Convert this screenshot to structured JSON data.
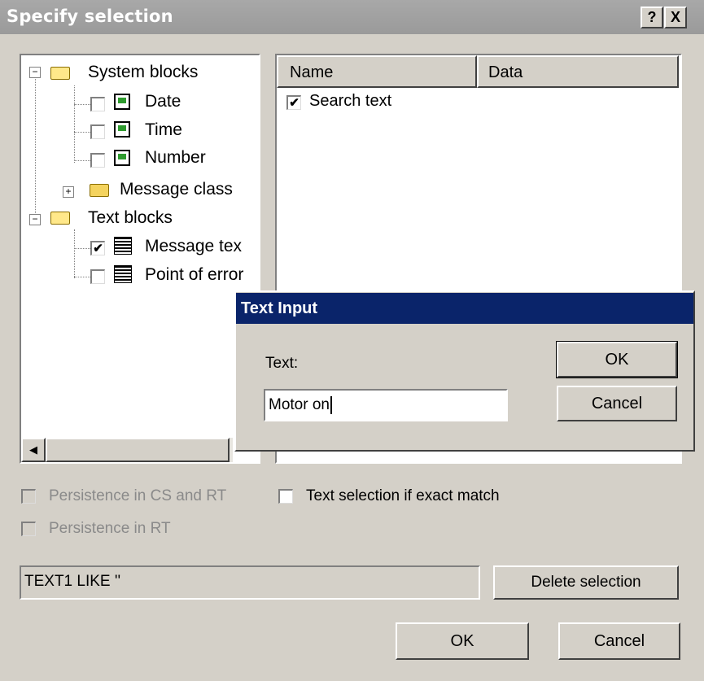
{
  "window": {
    "title": "Specify selection",
    "help_btn": "?",
    "close_btn": "X"
  },
  "tree": {
    "system_blocks": "System blocks",
    "date": "Date",
    "time": "Time",
    "number": "Number",
    "message_class": "Message class",
    "text_blocks": "Text blocks",
    "message_text": "Message tex",
    "point_of_error": "Point of error",
    "expand_minus": "−",
    "expand_plus": "+",
    "check_mark": "✔"
  },
  "list": {
    "columns": [
      "Name",
      "Data"
    ],
    "rows": [
      {
        "name": "Search text",
        "checked": true
      }
    ]
  },
  "options": {
    "persistence_cs_rt": "Persistence in CS and RT",
    "persistence_rt": "Persistence in RT",
    "exact_match": "Text selection if exact match"
  },
  "selection_expression": "TEXT1 LIKE ''",
  "buttons": {
    "delete_selection": "Delete selection",
    "ok": "OK",
    "cancel": "Cancel"
  },
  "text_input_dialog": {
    "title": "Text Input",
    "text_label": "Text:",
    "text_value": "Motor on",
    "ok": "OK",
    "cancel": "Cancel"
  },
  "scroll": {
    "left_arrow": "◀"
  }
}
